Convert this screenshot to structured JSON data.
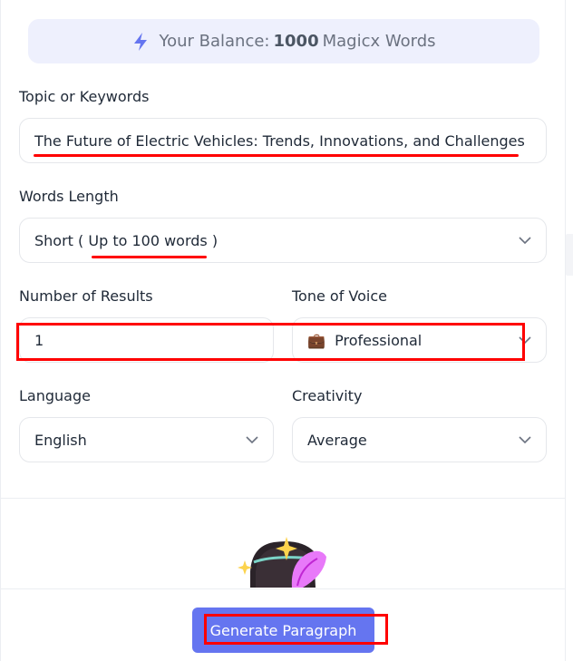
{
  "balance": {
    "prefix": "Your Balance:",
    "amount": "1000",
    "unit": "Magicx Words",
    "icon": "lightning-bolt-icon"
  },
  "form": {
    "topic": {
      "label": "Topic or Keywords",
      "value": "The Future of Electric Vehicles: Trends, Innovations, and Challenges"
    },
    "words_length": {
      "label": "Words Length",
      "value_prefix": "Short (",
      "value_highlight": "Up to 100 words",
      "value_suffix": ")"
    },
    "number_of_results": {
      "label": "Number of Results",
      "value": "1"
    },
    "tone_of_voice": {
      "label": "Tone of Voice",
      "emoji": "💼",
      "value": "Professional"
    },
    "language": {
      "label": "Language",
      "value": "English"
    },
    "creativity": {
      "label": "Creativity",
      "value": "Average"
    }
  },
  "generate_button": {
    "label": "Generate Paragraph"
  },
  "colors": {
    "accent": "#6575f0",
    "annotation": "#ff0000",
    "balance_bg": "#eef0fd"
  }
}
